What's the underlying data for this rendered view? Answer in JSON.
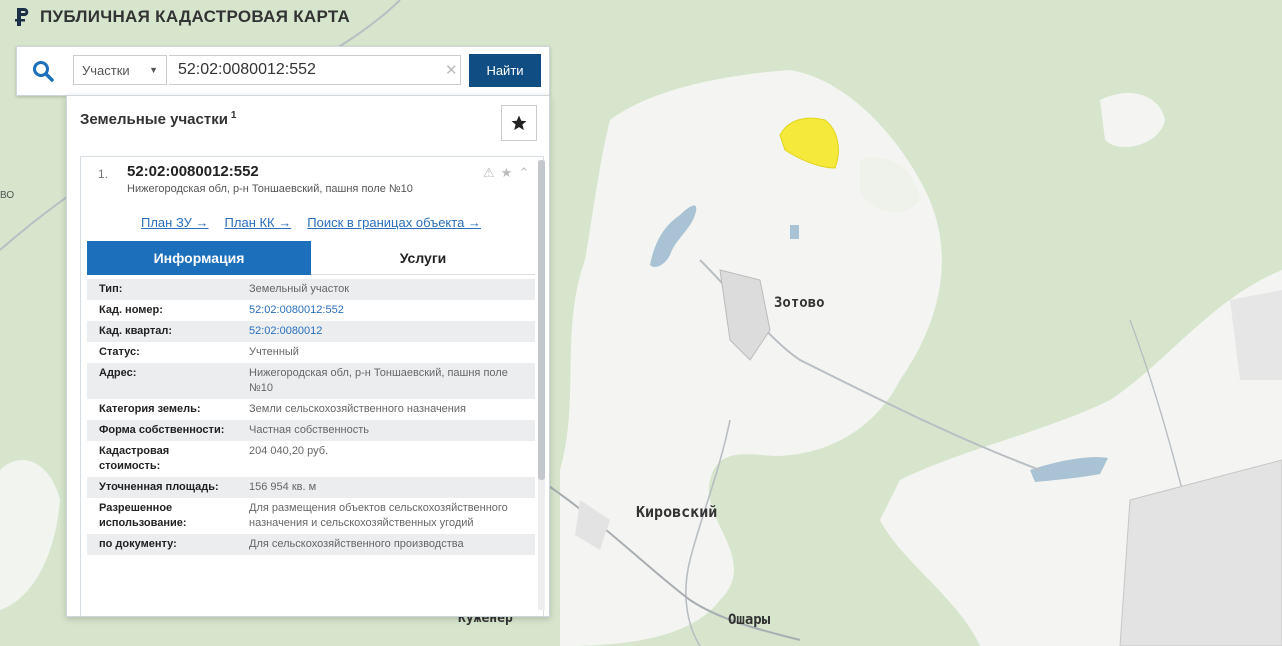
{
  "app": {
    "title": "ПУБЛИЧНАЯ КАДАСТРОВАЯ КАРТА"
  },
  "search": {
    "type_label": "Участки",
    "query": "52:02:0080012:552",
    "button_label": "Найти"
  },
  "results": {
    "header": "Земельные участки",
    "count": "1",
    "item": {
      "number": "1.",
      "cad_number": "52:02:0080012:552",
      "address": "Нижегородская обл, р-н Тоншаевский, пашня поле №10",
      "links": [
        "План ЗУ →",
        "План КК →",
        "Поиск в границах объекта →"
      ],
      "tabs": [
        "Информация",
        "Услуги"
      ],
      "fields": [
        {
          "label": "Тип:",
          "value": "Земельный участок"
        },
        {
          "label": "Кад. номер:",
          "value": "52:02:0080012:552"
        },
        {
          "label": "Кад. квартал:",
          "value": "52:02:0080012"
        },
        {
          "label": "Статус:",
          "value": "Учтенный"
        },
        {
          "label": "Адрес:",
          "value": "Нижегородская обл, р-н Тоншаевский, пашня поле №10"
        },
        {
          "label": "Категория земель:",
          "value": "Земли сельскохозяйственного назначения"
        },
        {
          "label": "Форма собственности:",
          "value": "Частная собственность"
        },
        {
          "label": "Кадастровая стоимость:",
          "value": "204 040,20 руб."
        },
        {
          "label": "Уточненная площадь:",
          "value": "156 954 кв. м"
        },
        {
          "label": "Разрешенное использование:",
          "value": "Для размещения объектов сельскохозяйственного назначения и сельскохозяйственных угодий"
        },
        {
          "label": "по документу:",
          "value": "Для сельскохозяйственного производства"
        }
      ]
    }
  },
  "map": {
    "labels": {
      "zotovo": "Зотово",
      "kirovsky": "Кировский",
      "osharы": "Ошары",
      "kuzhener": "Куженер"
    },
    "edge_label": "ВО"
  },
  "colors": {
    "accent": "#1c6fba",
    "button": "#0f4d83",
    "parcel": "#f5ea3b",
    "forest": "#d8e6cf",
    "open_land": "#f4f5f2",
    "water": "#a9c3d4"
  }
}
